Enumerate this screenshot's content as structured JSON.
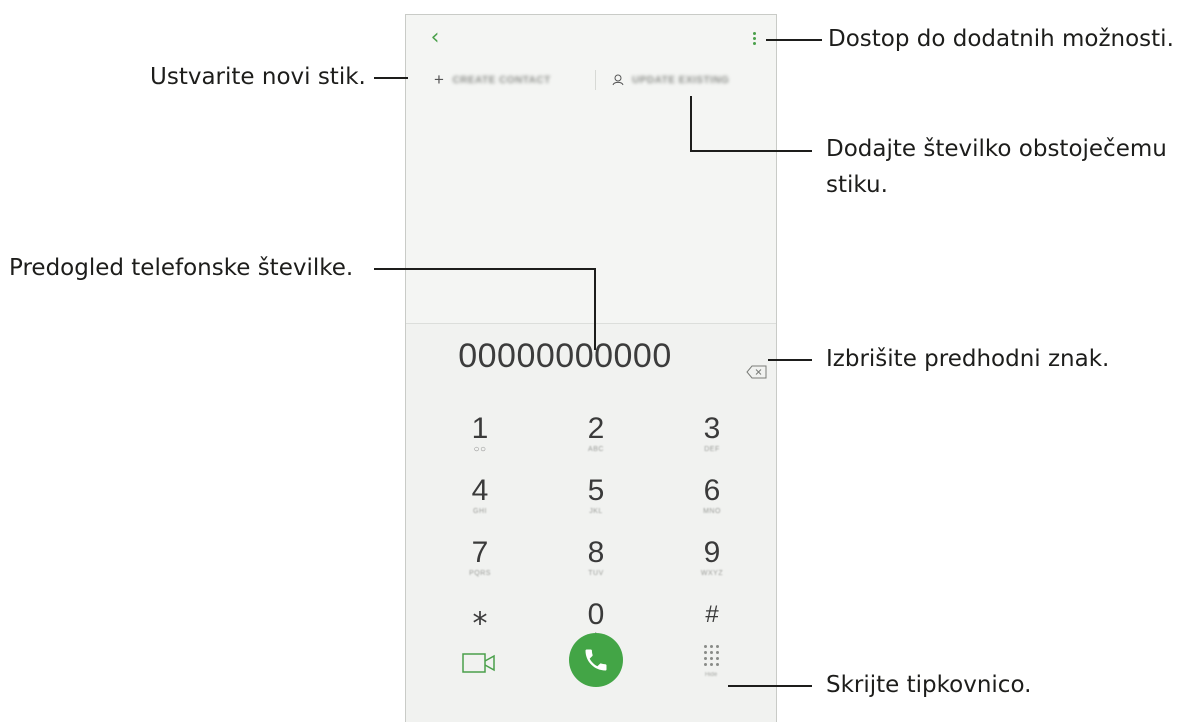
{
  "phone": {
    "back_icon": "chevron-left-icon",
    "more_icon": "more-vertical-icon",
    "create_contact_label": "CREATE CONTACT",
    "update_existing_label": "UPDATE EXISTING",
    "phone_number": "00000000000",
    "keys": [
      {
        "digit": "1",
        "sub": "○○"
      },
      {
        "digit": "2",
        "sub": "ABC"
      },
      {
        "digit": "3",
        "sub": "DEF"
      },
      {
        "digit": "4",
        "sub": "GHI"
      },
      {
        "digit": "5",
        "sub": "JKL"
      },
      {
        "digit": "6",
        "sub": "MNO"
      },
      {
        "digit": "7",
        "sub": "PQRS"
      },
      {
        "digit": "8",
        "sub": "TUV"
      },
      {
        "digit": "9",
        "sub": "WXYZ"
      },
      {
        "digit": "⁎",
        "sub": ""
      },
      {
        "digit": "0",
        "sub": "+"
      },
      {
        "digit": "#",
        "sub": ""
      }
    ],
    "keypad_caption": "Hide",
    "accent_color": "#43a546"
  },
  "callouts": {
    "more_options": "Dostop do dodatnih možnosti.",
    "create_contact": "Ustvarite novi stik.",
    "add_to_existing_line1": "Dodajte številko obstoječemu",
    "add_to_existing_line2": "stiku.",
    "number_preview": "Predogled telefonske številke.",
    "delete_char": "Izbrišite predhodni znak.",
    "hide_keypad": "Skrijte tipkovnico."
  }
}
